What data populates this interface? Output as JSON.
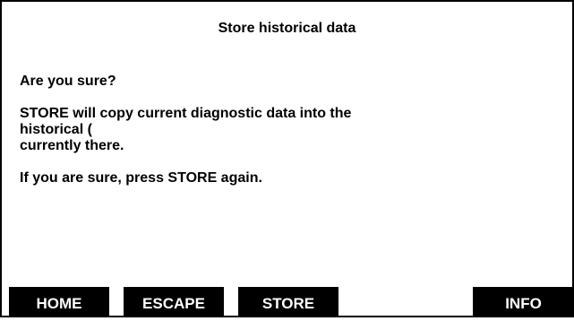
{
  "screen": {
    "title": "Store historical data",
    "lines": [
      "Are you sure?",
      "",
      "STORE will copy current diagnostic data into the",
      "historical (",
      "currently there.",
      "",
      "If you are sure, press STORE again."
    ]
  },
  "softkeys": [
    {
      "label": "HOME"
    },
    {
      "label": "ESCAPE"
    },
    {
      "label": "STORE"
    },
    {
      "label": "INFO"
    }
  ],
  "colors": {
    "background": "#ffffff",
    "text": "#000000",
    "softkey_bg": "#000000",
    "softkey_text": "#ffffff"
  }
}
